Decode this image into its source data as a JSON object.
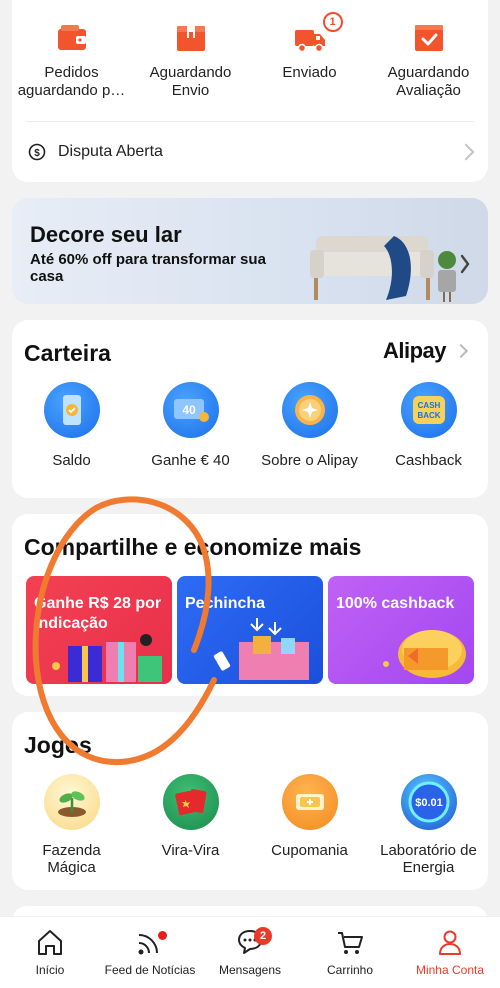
{
  "orders": {
    "items": [
      {
        "label": "Pedidos aguardando p…",
        "icon": "wallet-icon"
      },
      {
        "label": "Aguardando Envio",
        "icon": "package-icon"
      },
      {
        "label": "Enviado",
        "icon": "truck-icon",
        "badge": "1"
      },
      {
        "label": "Aguardando Avaliação",
        "icon": "review-icon"
      }
    ],
    "dispute_label": "Disputa Aberta"
  },
  "banner": {
    "title": "Decore seu lar",
    "subtitle": "Até 60% off para transformar sua casa"
  },
  "wallet": {
    "title": "Carteira",
    "brand": "Alipay",
    "items": [
      {
        "label": "Saldo",
        "icon": "phone-wallet-icon"
      },
      {
        "label": "Ganhe € 40",
        "icon": "coupon-40-icon",
        "icon_text": "40"
      },
      {
        "label": "Sobre o Alipay",
        "icon": "gold-coin-icon"
      },
      {
        "label": "Cashback",
        "icon": "cashback-icon",
        "icon_text_1": "CASH",
        "icon_text_2": "BACK"
      }
    ]
  },
  "share": {
    "title": "Compartilhe e economize mais",
    "promos": [
      {
        "title_1": "Ganhe R$ 28 por",
        "title_2": "indicação",
        "color": "#f0384a"
      },
      {
        "title_1": "Pechincha",
        "title_2": "",
        "color": "#1f5ff0"
      },
      {
        "title_1": "100% cashback",
        "title_2": "",
        "color": "#b44ff2"
      }
    ]
  },
  "games": {
    "title": "Jogos",
    "items": [
      {
        "label_1": "Fazenda",
        "label_2": "Mágica",
        "icon": "sprout-icon"
      },
      {
        "label_1": "Vira-Vira",
        "label_2": "",
        "icon": "cards-icon"
      },
      {
        "label_1": "Cupomania",
        "label_2": "",
        "icon": "ticket-icon"
      },
      {
        "label_1": "Laboratório de",
        "label_2": "Energia",
        "icon": "energy-coin-icon",
        "icon_text": "$0.01"
      }
    ]
  },
  "tabbar": {
    "tabs": [
      {
        "label": "Início",
        "icon": "home-icon"
      },
      {
        "label": "Feed de Notícias",
        "icon": "feed-icon"
      },
      {
        "label": "Mensagens",
        "icon": "chat-icon",
        "badge": "2"
      },
      {
        "label": "Carrinho",
        "icon": "cart-icon"
      },
      {
        "label": "Minha Conta",
        "icon": "user-icon",
        "active": true
      }
    ]
  },
  "colors": {
    "accent": "#ea3b2a",
    "annotation": "#f07a30"
  }
}
